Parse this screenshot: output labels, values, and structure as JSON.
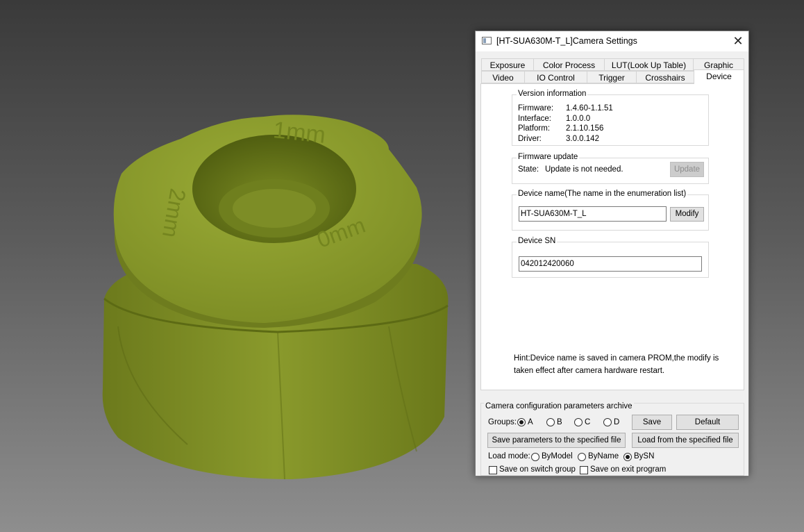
{
  "window": {
    "title": "[HT-SUA630M-T_L]Camera Settings",
    "close_glyph": "✕"
  },
  "tabs_row1": [
    {
      "label": "Exposure"
    },
    {
      "label": "Color Process"
    },
    {
      "label": "LUT(Look Up Table)"
    },
    {
      "label": "Graphic"
    }
  ],
  "tabs_row2": [
    {
      "label": "Video"
    },
    {
      "label": "IO Control"
    },
    {
      "label": "Trigger"
    },
    {
      "label": "Crosshairs"
    },
    {
      "label": "Device",
      "active": true
    }
  ],
  "version_info": {
    "title": "Version information",
    "rows": [
      {
        "label": "Firmware:",
        "value": "1.4.60-1.1.51"
      },
      {
        "label": "Interface:",
        "value": "1.0.0.0"
      },
      {
        "label": "Platform:",
        "value": "2.1.10.156"
      },
      {
        "label": "Driver:",
        "value": "3.0.0.142"
      }
    ]
  },
  "firmware_update": {
    "title": "Firmware update",
    "state_label": "State:",
    "state_value": "Update is not needed.",
    "button": "Update"
  },
  "device_name": {
    "title": "Device name(The name in the enumeration list)",
    "value": "HT-SUA630M-T_L",
    "button": "Modify"
  },
  "device_sn": {
    "title": "Device SN",
    "value": "042012420060"
  },
  "hint": {
    "line1": "Hint:Device name is saved in camera PROM,the modify is",
    "line2": "taken effect after camera hardware restart."
  },
  "archive": {
    "title": "Camera configuration parameters archive",
    "groups_label": "Groups:",
    "groups": [
      {
        "label": "A",
        "selected": true
      },
      {
        "label": "B",
        "selected": false
      },
      {
        "label": "C",
        "selected": false
      },
      {
        "label": "D",
        "selected": false
      }
    ],
    "save_button": "Save",
    "default_button": "Default",
    "save_file_button": "Save parameters to the specified file",
    "load_file_button": "Load from the specified file",
    "load_mode_label": "Load mode:",
    "load_modes": [
      {
        "label": "ByModel",
        "selected": false
      },
      {
        "label": "ByName",
        "selected": false
      },
      {
        "label": "BySN",
        "selected": true
      }
    ],
    "save_on_switch": {
      "label": "Save on switch group",
      "checked": false
    },
    "save_on_exit": {
      "label": "Save on exit program",
      "checked": false
    }
  },
  "colors": {
    "model_green": "#8a9a2c",
    "dialog_bg": "#f0f0f0"
  }
}
